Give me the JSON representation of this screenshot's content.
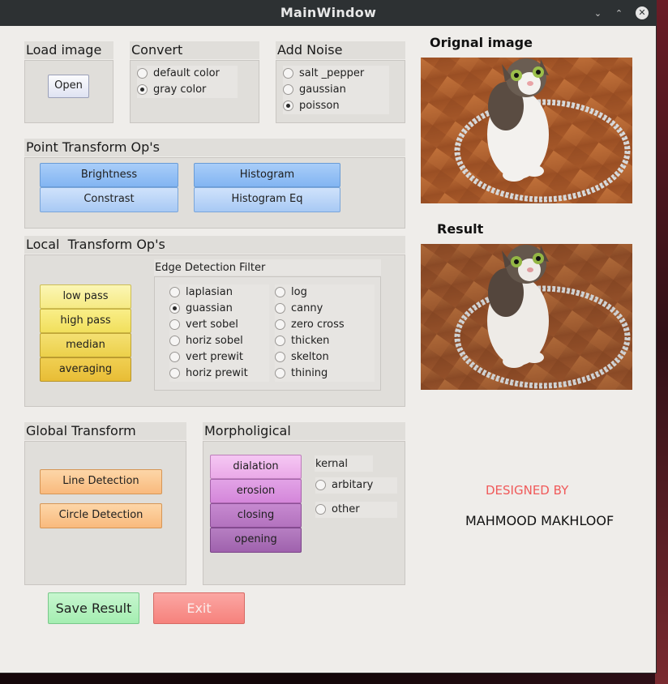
{
  "window": {
    "title": "MainWindow",
    "minimize_glyph": "⌄",
    "restore_glyph": "⌃",
    "close_glyph": "✕"
  },
  "load_image": {
    "title": "Load image",
    "open_label": "Open"
  },
  "convert": {
    "title": "Convert",
    "options": [
      {
        "label": "default color",
        "checked": false
      },
      {
        "label": "gray color",
        "checked": true
      }
    ]
  },
  "add_noise": {
    "title": "Add Noise",
    "options": [
      {
        "label": "salt _pepper",
        "checked": false
      },
      {
        "label": "gaussian",
        "checked": false
      },
      {
        "label": "poisson",
        "checked": true
      }
    ]
  },
  "point_transform": {
    "title": "Point Transform Op's",
    "buttons": [
      "Brightness",
      "Histogram",
      "Constrast",
      "Histogram Eq"
    ]
  },
  "local_transform": {
    "title": "Local  Transform Op's",
    "filters": [
      "low pass",
      "high pass",
      "median",
      "averaging"
    ],
    "edge_title": "Edge Detection Filter",
    "edge_left": [
      {
        "label": "laplasian",
        "checked": false
      },
      {
        "label": "guassian",
        "checked": true
      },
      {
        "label": "vert sobel",
        "checked": false
      },
      {
        "label": "horiz sobel",
        "checked": false
      },
      {
        "label": "vert prewit",
        "checked": false
      },
      {
        "label": "horiz prewit",
        "checked": false
      }
    ],
    "edge_right": [
      {
        "label": "log",
        "checked": false
      },
      {
        "label": "canny",
        "checked": false
      },
      {
        "label": "zero cross",
        "checked": false
      },
      {
        "label": "thicken",
        "checked": false
      },
      {
        "label": "skelton",
        "checked": false
      },
      {
        "label": "thining",
        "checked": false
      }
    ]
  },
  "global_transform": {
    "title": "Global Transform",
    "buttons": [
      "Line Detection",
      "Circle Detection"
    ]
  },
  "morphological": {
    "title": "Morpholigical",
    "buttons": [
      "dialation",
      "erosion",
      "closing",
      "opening"
    ],
    "kernal_label": "kernal",
    "kernal_options": [
      {
        "label": "arbitary",
        "checked": false
      },
      {
        "label": "other",
        "checked": false
      }
    ]
  },
  "actions": {
    "save_label": "Save Result",
    "exit_label": "Exit"
  },
  "images": {
    "original_title": "Orignal image",
    "result_title": "Result",
    "original_tone": "color",
    "result_tone": "color"
  },
  "credits": {
    "designed_by": "DESIGNED BY",
    "author": "MAHMOOD MAKHLOOF",
    "designed_by_color": "#f05a5a"
  }
}
